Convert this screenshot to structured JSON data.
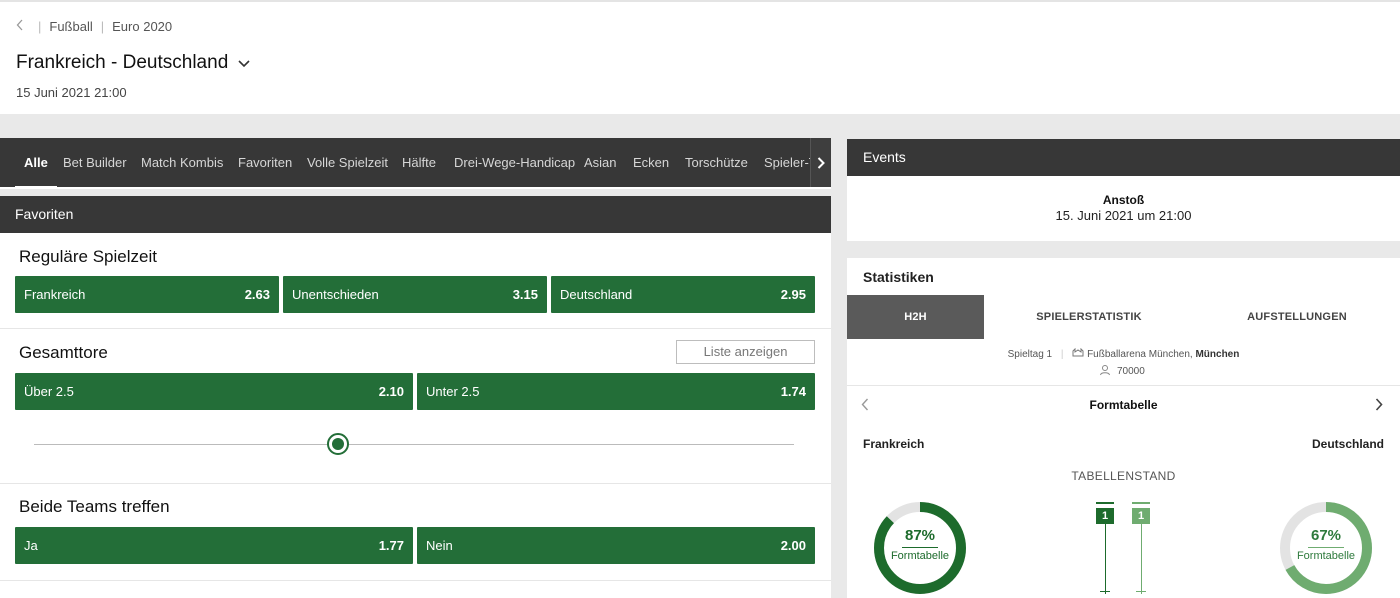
{
  "header": {
    "breadcrumb": [
      "Fußball",
      "Euro 2020"
    ],
    "title": "Frankreich - Deutschland",
    "date": "15 Juni 2021 21:00"
  },
  "tabs": [
    "Alle",
    "Bet Builder",
    "Match Kombis",
    "Favoriten",
    "Volle Spielzeit",
    "Hälfte",
    "Drei-Wege-Handicap",
    "Asian",
    "Ecken",
    "Torschütze",
    "Spieler-Tore"
  ],
  "section_title": "Favoriten",
  "markets": {
    "regular": {
      "title": "Reguläre Spielzeit",
      "odds": [
        {
          "label": "Frankreich",
          "value": "2.63"
        },
        {
          "label": "Unentschieden",
          "value": "3.15"
        },
        {
          "label": "Deutschland",
          "value": "2.95"
        }
      ]
    },
    "total": {
      "title": "Gesamttore",
      "list_button": "Liste anzeigen",
      "odds": [
        {
          "label": "Über 2.5",
          "value": "2.10"
        },
        {
          "label": "Unter 2.5",
          "value": "1.74"
        }
      ],
      "slider_position": 0.4
    },
    "btts": {
      "title": "Beide Teams treffen",
      "odds": [
        {
          "label": "Ja",
          "value": "1.77"
        },
        {
          "label": "Nein",
          "value": "2.00"
        }
      ]
    }
  },
  "events": {
    "title": "Events",
    "kickoff_label": "Anstoß",
    "kickoff_date": "15. Juni 2021 um 21:00"
  },
  "stats": {
    "title": "Statistiken",
    "tabs": [
      "H2H",
      "SPIELERSTATISTIK",
      "AUFSTELLUNGEN"
    ],
    "matchday": "Spieltag 1",
    "venue": "Fußballarena München,",
    "city": "München",
    "capacity": "70000",
    "form_title": "Formtabelle",
    "team_home": "Frankreich",
    "team_away": "Deutschland",
    "standing_label": "TABELLENSTAND",
    "home_form_pct": "87%",
    "away_form_pct": "67%",
    "home_form_value": 0.87,
    "away_form_value": 0.67,
    "form_ring_label": "Formtabelle",
    "home_rank": "1",
    "away_rank": "1"
  },
  "colors": {
    "odds_green": "#236e38",
    "home_green": "#1d6b2c",
    "away_green": "#6fac70",
    "dark_bar": "#373737"
  }
}
